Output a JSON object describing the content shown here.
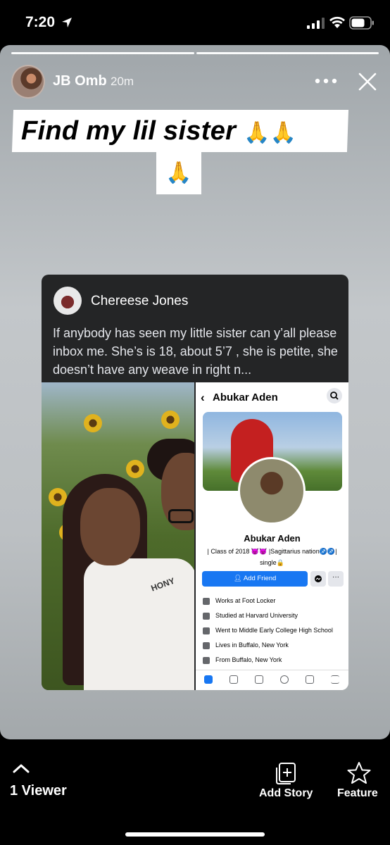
{
  "status_bar": {
    "time": "7:20"
  },
  "story": {
    "username": "JB Omb",
    "time_ago": "20m",
    "caption_line1": "Find my lil sister",
    "caption_emoji1": "🙏🙏",
    "caption_emoji2": "🙏"
  },
  "shared_post": {
    "author": "Chereese Jones",
    "text": "If anybody has seen my little sister can y’all please inbox me. She’s is 18, about 5’7 , she is petite, she doesn’t have any weave in right n...",
    "shirt_text": "HONY"
  },
  "fb_profile": {
    "back_glyph": "‹",
    "header_name": "Abukar Aden",
    "name": "Abukar Aden",
    "bio_line1": "| Class of 2018 😈😈 |Sagittarius nation♐♐|",
    "bio_line2": "single🔒",
    "add_friend": "Add Friend",
    "more_glyph": "···",
    "info": [
      "Works at Foot Locker",
      "Studied at Harvard University",
      "Went to Middle Early College High School",
      "Lives in Buffalo, New York",
      "From Buffalo, New York"
    ]
  },
  "bottom_bar": {
    "viewers": "1 Viewer",
    "add_story": "Add Story",
    "feature": "Feature"
  }
}
